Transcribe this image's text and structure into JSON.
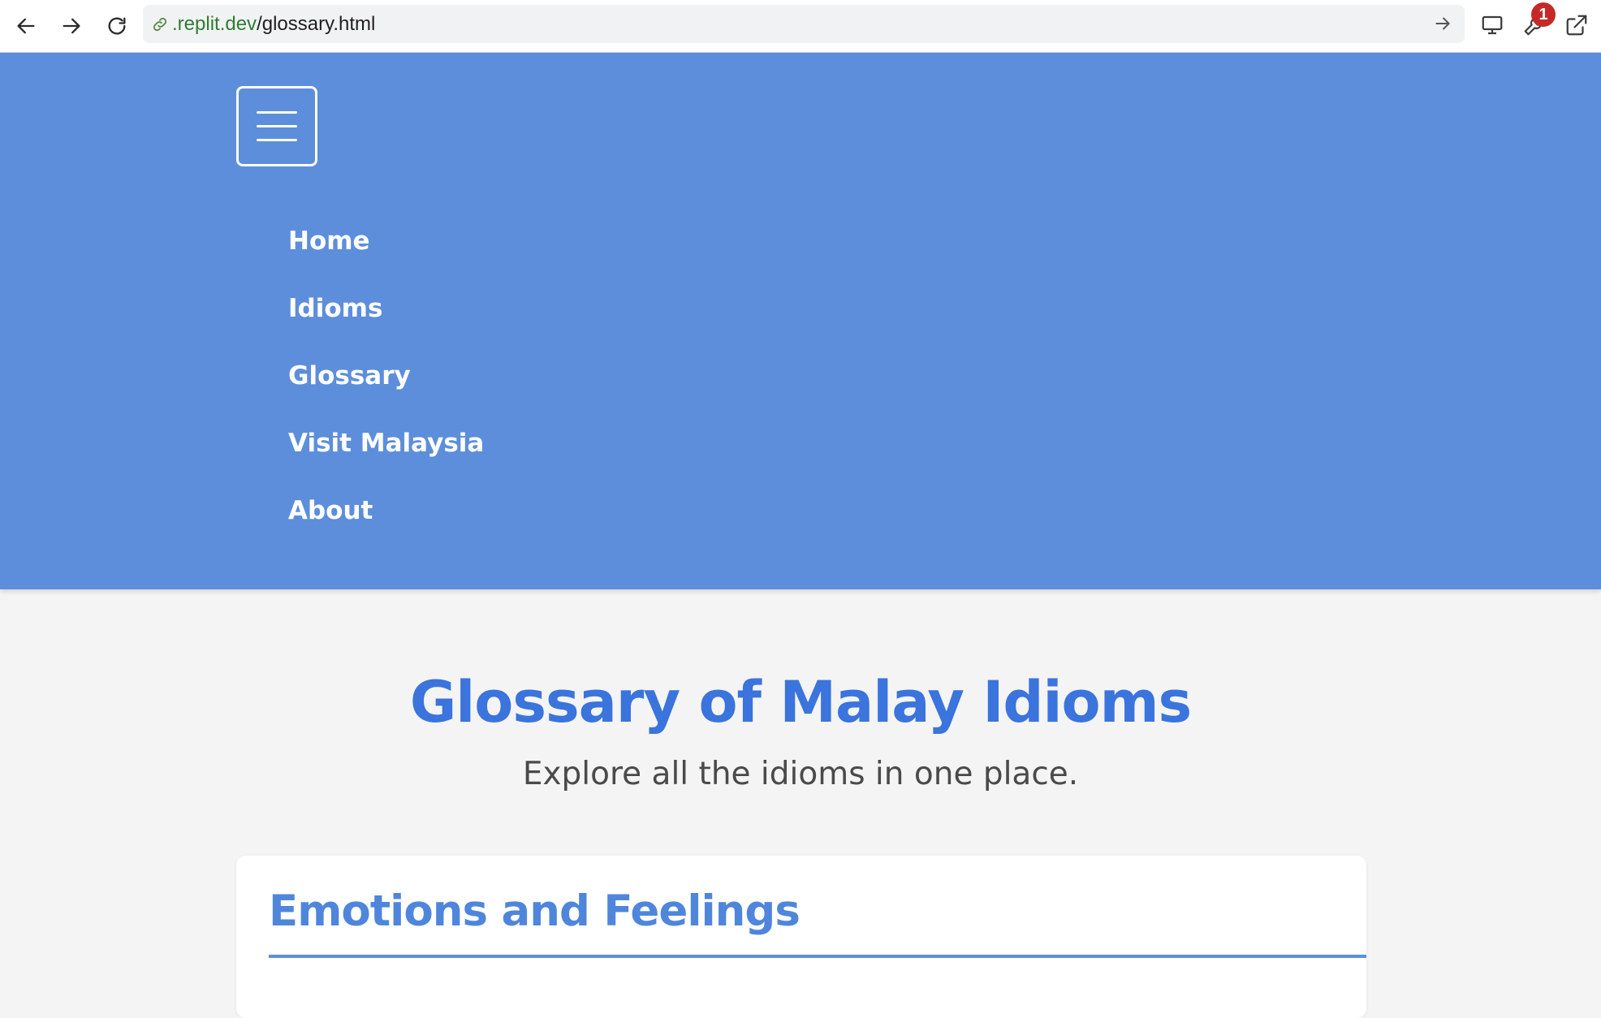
{
  "browser": {
    "url_domain": ".replit.dev",
    "url_path": "/glossary.html",
    "notification_count": "1"
  },
  "nav": {
    "items": [
      {
        "label": "Home"
      },
      {
        "label": "Idioms"
      },
      {
        "label": "Glossary"
      },
      {
        "label": "Visit Malaysia"
      },
      {
        "label": "About"
      }
    ]
  },
  "main": {
    "title": "Glossary of Malay Idioms",
    "subtitle": "Explore all the idioms in one place.",
    "categories": [
      {
        "heading": "Emotions and Feelings"
      }
    ]
  },
  "colors": {
    "header_bg": "#5d8edc",
    "title": "#3a74dc",
    "category_heading": "#4f86db",
    "page_bg": "#f4f4f5"
  },
  "icons": {
    "back": "arrow-left-icon",
    "forward": "arrow-right-icon",
    "reload": "reload-icon",
    "link": "link-icon",
    "go": "arrow-right-icon",
    "device": "monitor-icon",
    "devtools": "wrench-icon",
    "open_external": "external-link-icon",
    "menu": "hamburger-menu-icon"
  }
}
